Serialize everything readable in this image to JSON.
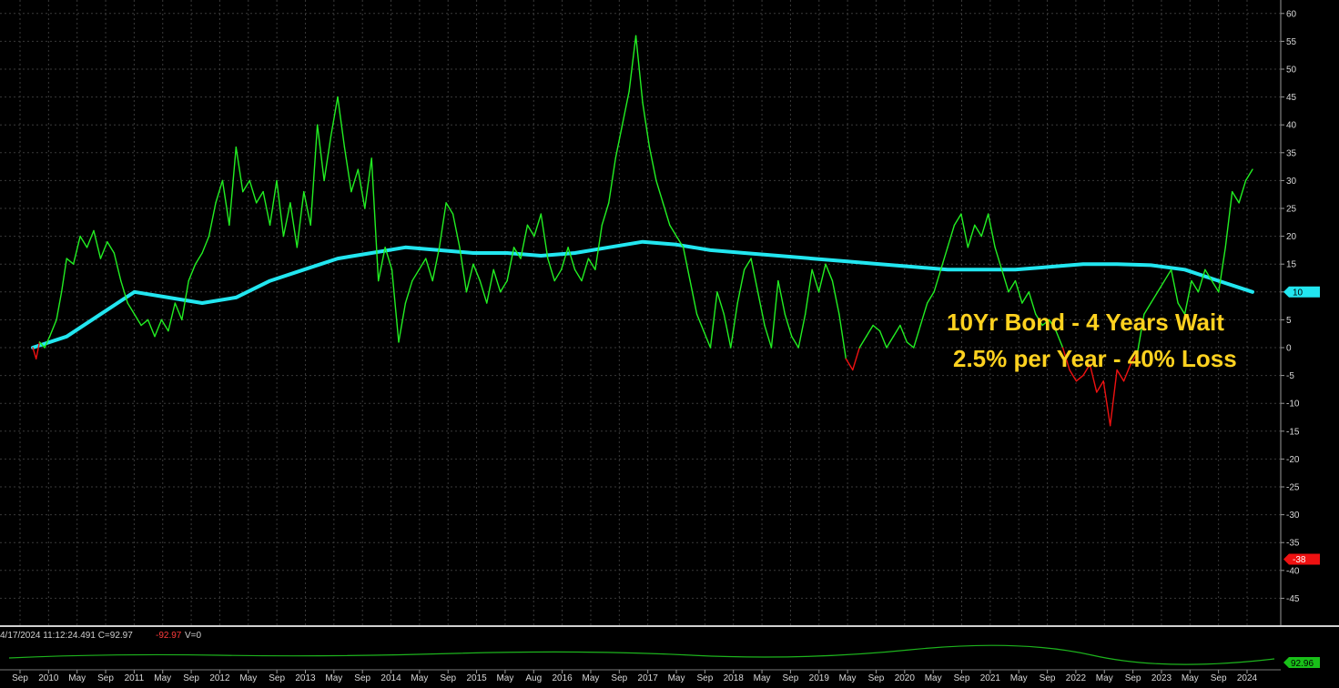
{
  "chart_data": {
    "type": "line",
    "title": "",
    "xlabel": "",
    "ylabel": "",
    "ylim": [
      -50,
      62
    ],
    "yticks": [
      60,
      55,
      50,
      45,
      40,
      35,
      30,
      25,
      20,
      15,
      10,
      5,
      0,
      -5,
      -10,
      -15,
      -20,
      -25,
      -30,
      -35,
      -40,
      -45
    ],
    "x_axis_labels": [
      "Sep",
      "2010",
      "May",
      "Sep",
      "2011",
      "May",
      "Sep",
      "2012",
      "May",
      "Sep",
      "2013",
      "May",
      "Sep",
      "2014",
      "May",
      "Sep",
      "2015",
      "May",
      "Aug",
      "2016",
      "May",
      "Sep",
      "2017",
      "May",
      "Sep",
      "2018",
      "May",
      "Sep",
      "2019",
      "May",
      "Sep",
      "2020",
      "May",
      "Sep",
      "2021",
      "May",
      "Sep",
      "2022",
      "May",
      "Sep",
      "2023",
      "May",
      "Sep",
      "2024"
    ],
    "grid": true,
    "series": [
      {
        "color_up": "#22ee22",
        "color_down": "#ee1111",
        "x": [
          0,
          2,
          4,
          7,
          10,
          14,
          17,
          20,
          24,
          28,
          32,
          36,
          40,
          44,
          48,
          52,
          56,
          60,
          64,
          68,
          72,
          76,
          80,
          84,
          88,
          92,
          96,
          100,
          104,
          108,
          112,
          116,
          120,
          124,
          128,
          132,
          136,
          140,
          144,
          148,
          152,
          156,
          160,
          164,
          168,
          172,
          176,
          180,
          184,
          188,
          192,
          196,
          200,
          204,
          208,
          212,
          216,
          220,
          224,
          228,
          232,
          236,
          240,
          244,
          248,
          252,
          256,
          260,
          264,
          268,
          272,
          276,
          280,
          284,
          288,
          292,
          296,
          300,
          304,
          308,
          312,
          316,
          320,
          324,
          328,
          332,
          336,
          340,
          344,
          348,
          352,
          356,
          360,
          364,
          368,
          372,
          376,
          380,
          384,
          388,
          392,
          396,
          400,
          404,
          408,
          412,
          416,
          420,
          424,
          428,
          432,
          436,
          440,
          444,
          448,
          452,
          456,
          460,
          464,
          468,
          472,
          476,
          480,
          484,
          488,
          492,
          496,
          500,
          504,
          508,
          512,
          516,
          520,
          524,
          528,
          532,
          536,
          540,
          544,
          548,
          552,
          556,
          560,
          564,
          568,
          572,
          576,
          580,
          584,
          588,
          592,
          596,
          600,
          604,
          608,
          612,
          616,
          620,
          624,
          628,
          632,
          636,
          640,
          644,
          648,
          652,
          656,
          660,
          664,
          668,
          672,
          676,
          680,
          684,
          688,
          692,
          696,
          700,
          704,
          708,
          712,
          716,
          720
        ],
        "y": [
          0,
          -2,
          1,
          0,
          2,
          5,
          10,
          16,
          15,
          20,
          18,
          21,
          16,
          19,
          17,
          12,
          8,
          6,
          4,
          5,
          2,
          5,
          3,
          8,
          5,
          12,
          15,
          17,
          20,
          26,
          30,
          22,
          36,
          28,
          30,
          26,
          28,
          22,
          30,
          20,
          26,
          18,
          28,
          22,
          40,
          30,
          38,
          45,
          36,
          28,
          32,
          25,
          34,
          12,
          18,
          14,
          1,
          8,
          12,
          14,
          16,
          12,
          18,
          26,
          24,
          18,
          10,
          15,
          12,
          8,
          14,
          10,
          12,
          18,
          16,
          22,
          20,
          24,
          16,
          12,
          14,
          18,
          14,
          12,
          16,
          14,
          22,
          26,
          34,
          40,
          46,
          56,
          44,
          36,
          30,
          26,
          22,
          20,
          18,
          12,
          6,
          3,
          0,
          10,
          6,
          0,
          8,
          14,
          16,
          10,
          4,
          0,
          12,
          6,
          2,
          0,
          6,
          14,
          10,
          15,
          12,
          6,
          -2,
          -4,
          0,
          2,
          4,
          3,
          0,
          2,
          4,
          1,
          0,
          4,
          8,
          10,
          14,
          18,
          22,
          24,
          18,
          22,
          20,
          24,
          18,
          14,
          10,
          12,
          8,
          10,
          6,
          4,
          5,
          3,
          0,
          -4,
          -6,
          -5,
          -3,
          -8,
          -6,
          -14,
          -4,
          -6,
          -3,
          -1,
          6,
          8,
          10,
          12,
          14,
          8,
          6,
          12,
          10,
          14,
          12,
          10,
          18,
          28,
          26,
          30,
          32
        ]
      },
      {
        "color": "#22e6f0",
        "x": [
          0,
          20,
          40,
          60,
          80,
          100,
          120,
          140,
          160,
          180,
          200,
          220,
          240,
          260,
          280,
          300,
          320,
          340,
          360,
          380,
          400,
          420,
          440,
          460,
          480,
          500,
          520,
          540,
          560,
          580,
          600,
          620,
          640,
          660,
          680,
          700,
          720
        ],
        "y": [
          0,
          2,
          6,
          10,
          9,
          8,
          9,
          12,
          14,
          16,
          17,
          18,
          17.5,
          17,
          17,
          16.5,
          17,
          18,
          19,
          18.5,
          17.5,
          17,
          16.5,
          16,
          15.5,
          15,
          14.5,
          14,
          14,
          14,
          14.5,
          15,
          15,
          14.8,
          14,
          12,
          10
        ]
      }
    ],
    "last_value_flags": [
      {
        "value": "10",
        "color": "#22e6f0"
      },
      {
        "value": "-38",
        "color": "#ee1111"
      }
    ]
  },
  "annotation": {
    "line1": "10Yr Bond - 4 Years Wait",
    "line2": "2.5% per Year - 40% Loss"
  },
  "lower_pane": {
    "status": "4/17/2024 11:12:24.491 C=92.97",
    "change": "-92.97",
    "volume": "V=0",
    "flag": "92.96"
  }
}
